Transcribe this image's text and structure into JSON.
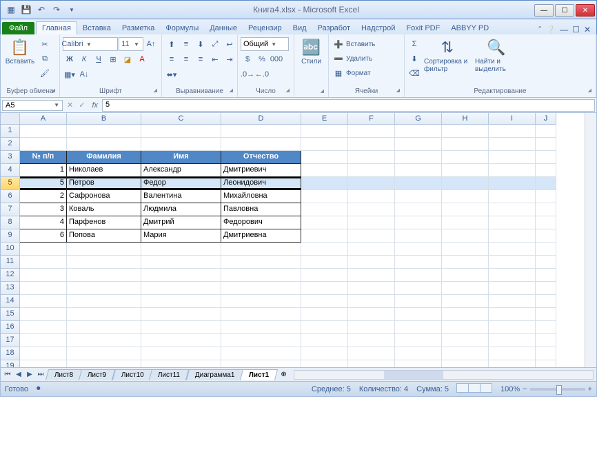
{
  "window": {
    "title": "Книга4.xlsx - Microsoft Excel"
  },
  "tabs": {
    "file": "Файл",
    "items": [
      "Главная",
      "Вставка",
      "Разметка",
      "Формулы",
      "Данные",
      "Рецензир",
      "Вид",
      "Разработ",
      "Надстрой",
      "Foxit PDF",
      "ABBYY PD"
    ],
    "active": 0
  },
  "ribbon": {
    "clipboard": {
      "paste": "Вставить",
      "label": "Буфер обмена"
    },
    "font": {
      "name": "Calibri",
      "size": "11",
      "label": "Шрифт"
    },
    "alignment": {
      "label": "Выравнивание"
    },
    "number": {
      "format": "Общий",
      "label": "Число"
    },
    "styles": {
      "btn": "Стили"
    },
    "cells": {
      "insert": "Вставить",
      "delete": "Удалить",
      "format": "Формат",
      "label": "Ячейки"
    },
    "editing": {
      "sort": "Сортировка и фильтр",
      "find": "Найти и выделить",
      "label": "Редактирование"
    }
  },
  "formula_bar": {
    "name_box": "A5",
    "value": "5"
  },
  "columns": [
    "A",
    "B",
    "C",
    "D",
    "E",
    "F",
    "G",
    "H",
    "I",
    "J"
  ],
  "selected_row": 5,
  "table": {
    "headers": [
      "№ п/п",
      "Фамилия",
      "Имя",
      "Отчество"
    ],
    "rows": [
      {
        "n": "1",
        "f": "Николаев",
        "i": "Александр",
        "o": "Дмитриевич"
      },
      {
        "n": "5",
        "f": "Петров",
        "i": "Федор",
        "o": "Леонидович"
      },
      {
        "n": "2",
        "f": "Сафронова",
        "i": "Валентина",
        "o": "Михайловна"
      },
      {
        "n": "3",
        "f": "Коваль",
        "i": "Людмила",
        "o": "Павловна"
      },
      {
        "n": "4",
        "f": "Парфенов",
        "i": "Дмитрий",
        "o": "Федорович"
      },
      {
        "n": "6",
        "f": "Попова",
        "i": "Мария",
        "o": "Дмитриевна"
      }
    ]
  },
  "sheets": {
    "items": [
      "Лист8",
      "Лист9",
      "Лист10",
      "Лист11",
      "Диаграмма1",
      "Лист1"
    ],
    "active": 5
  },
  "status": {
    "ready": "Готово",
    "avg_label": "Среднее:",
    "avg": "5",
    "count_label": "Количество:",
    "count": "4",
    "sum_label": "Сумма:",
    "sum": "5",
    "zoom": "100%"
  }
}
